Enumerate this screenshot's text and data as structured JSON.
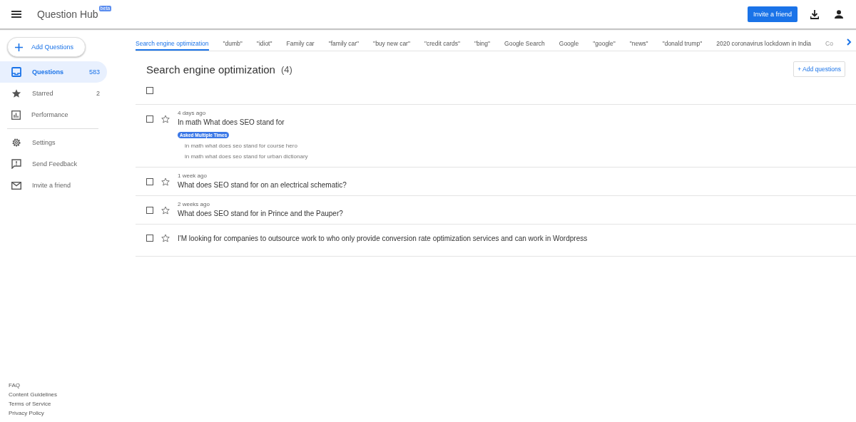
{
  "header": {
    "title": "Question Hub",
    "badge": "beta",
    "invite_button": "Invite a friend"
  },
  "sidebar": {
    "add_button": "Add Questions",
    "items": [
      {
        "kind": "questions",
        "label": "Questions",
        "count": "583",
        "selected": true
      },
      {
        "kind": "starred",
        "label": "Starred",
        "count": "2",
        "selected": false
      },
      {
        "kind": "performance",
        "label": "Performance",
        "selected": false
      }
    ],
    "secondary": [
      {
        "kind": "settings",
        "label": "Settings"
      },
      {
        "kind": "feedback",
        "label": "Send Feedback"
      },
      {
        "kind": "mail",
        "label": "Invite a friend"
      }
    ],
    "footer_links": [
      "FAQ",
      "Content Guidelines",
      "Terms of Service",
      "Privacy Policy"
    ]
  },
  "tabs": [
    {
      "label": "Search engine optimization",
      "selected": true
    },
    {
      "label": "\"dumb\"",
      "selected": false
    },
    {
      "label": "\"idiot\"",
      "selected": false
    },
    {
      "label": "Family car",
      "selected": false
    },
    {
      "label": "\"family car\"",
      "selected": false
    },
    {
      "label": "\"buy new car\"",
      "selected": false
    },
    {
      "label": "\"credit cards\"",
      "selected": false
    },
    {
      "label": "\"bing\"",
      "selected": false
    },
    {
      "label": "Google Search",
      "selected": false
    },
    {
      "label": "Google",
      "selected": false
    },
    {
      "label": "\"google\"",
      "selected": false
    },
    {
      "label": "\"news\"",
      "selected": false
    },
    {
      "label": "\"donald trump\"",
      "selected": false
    },
    {
      "label": "2020 coronavirus lockdown in India",
      "selected": false
    },
    {
      "label": "Co",
      "selected": false
    }
  ],
  "topic": {
    "title": "Search engine optimization",
    "count": "(4)",
    "add_button": "+ Add questions",
    "select_all_checked": false
  },
  "questions": [
    {
      "time": "4 days ago",
      "title": "In math What does SEO stand for",
      "badge": "Asked Multiple Times",
      "related": [
        "in math what does seo stand for course hero",
        "in math what does seo stand for urban dictionary"
      ],
      "checked": false,
      "starred": false
    },
    {
      "time": "1 week ago",
      "title": "What does SEO stand for on an electrical schematic?",
      "checked": false,
      "starred": false
    },
    {
      "time": "2 weeks ago",
      "title": "What does SEO stand for in Prince and the Pauper?",
      "checked": false,
      "starred": false
    },
    {
      "title": "I'M looking for companies to outsource work to who only provide conversion rate optimization services and can work in Wordpress",
      "checked": false,
      "starred": false
    }
  ]
}
